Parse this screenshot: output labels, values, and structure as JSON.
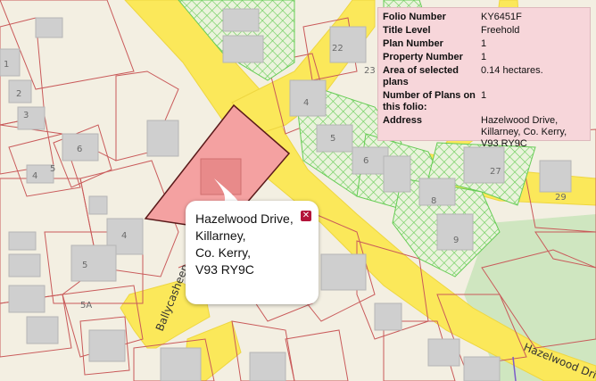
{
  "info": {
    "rows": [
      {
        "label": "Folio Number",
        "value": "KY6451F"
      },
      {
        "label": "Title Level",
        "value": "Freehold"
      },
      {
        "label": "Plan Number",
        "value": "1"
      },
      {
        "label": "Property Number",
        "value": "1"
      },
      {
        "label": "Area of selected plans",
        "value": "0.14 hectares."
      },
      {
        "label": "Number of Plans on this folio:",
        "value": "1"
      },
      {
        "label": "Address",
        "value": "Hazelwood Drive, Killarney, Co. Kerry, V93 RY9C"
      }
    ]
  },
  "popup": {
    "lines": [
      "Hazelwood Drive,",
      "Killarney,",
      "Co. Kerry,",
      "V93 RY9C"
    ],
    "close_icon": "close-icon"
  },
  "map": {
    "house_numbers": [
      "1",
      "2",
      "3",
      "4",
      "5",
      "6",
      "22",
      "23",
      "4",
      "5",
      "6",
      "27",
      "8",
      "9",
      "29",
      "4",
      "5",
      "5A"
    ],
    "road_labels": [
      "Ballycasheen",
      "Hazelwood Drive"
    ],
    "colors": {
      "selected_parcel": "#f4a1a1",
      "road": "#fbe85a",
      "boundary": "#c95a5a",
      "hatched_parcel": "#66cc55",
      "building": "#cfcfcf",
      "green_area": "#cfe6c0"
    }
  }
}
